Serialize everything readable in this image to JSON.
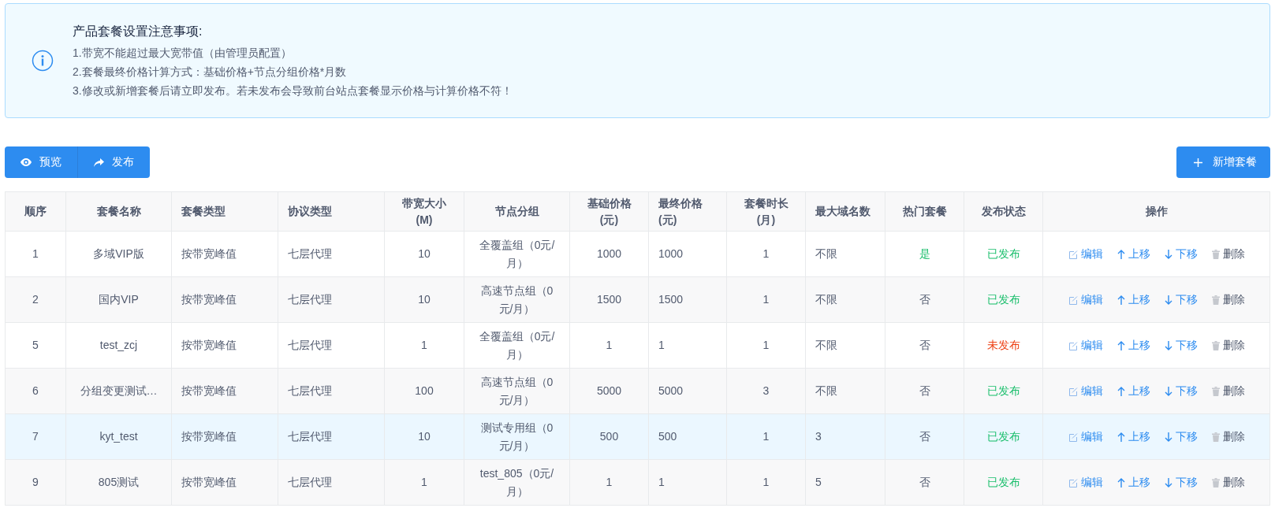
{
  "notice": {
    "title": "产品套餐设置注意事项:",
    "items": [
      "1.带宽不能超过最大宽带值（由管理员配置）",
      "2.套餐最终价格计算方式：基础价格+节点分组价格*月数",
      "3.修改或新增套餐后请立即发布。若未发布会导致前台站点套餐显示价格与计算价格不符！"
    ]
  },
  "toolbar": {
    "buttons": [
      {
        "label": "预览",
        "kind": "preview"
      },
      {
        "label": "发布",
        "kind": "publish"
      }
    ],
    "add_button": {
      "label": "新增套餐"
    }
  },
  "table": {
    "columns": [
      "顺序",
      "套餐名称",
      "套餐类型",
      "协议类型",
      "带宽大小(M)",
      "节点分组",
      "基础价格(元)",
      "最终价格(元)",
      "套餐时长(月)",
      "最大域名数",
      "热门套餐",
      "发布状态",
      "操作"
    ],
    "rows": [
      {
        "selected": false,
        "cells": [
          "1",
          "多域VIP版",
          "按带宽峰值",
          "七层代理",
          "10",
          "全覆盖组（0元/月）",
          "1000",
          "1000",
          "1",
          "不限"
        ],
        "hot": {
          "text": "是",
          "on": true
        },
        "status": {
          "text": "已发布",
          "published": true
        },
        "actions": [
          {
            "label": "编辑",
            "kind": "edit"
          },
          {
            "label": "上移",
            "kind": "up"
          },
          {
            "label": "下移",
            "kind": "down"
          },
          {
            "label": "删除",
            "kind": "delete"
          }
        ]
      },
      {
        "selected": false,
        "cells": [
          "2",
          "国内VIP",
          "按带宽峰值",
          "七层代理",
          "10",
          "高速节点组（0元/月）",
          "1500",
          "1500",
          "1",
          "不限"
        ],
        "hot": {
          "text": "否",
          "on": false
        },
        "status": {
          "text": "已发布",
          "published": true
        },
        "actions": [
          {
            "label": "编辑",
            "kind": "edit"
          },
          {
            "label": "上移",
            "kind": "up"
          },
          {
            "label": "下移",
            "kind": "down"
          },
          {
            "label": "删除",
            "kind": "delete"
          }
        ]
      },
      {
        "selected": false,
        "cells": [
          "5",
          "test_zcj",
          "按带宽峰值",
          "七层代理",
          "1",
          "全覆盖组（0元/月）",
          "1",
          "1",
          "1",
          "不限"
        ],
        "hot": {
          "text": "否",
          "on": false
        },
        "status": {
          "text": "未发布",
          "published": false
        },
        "actions": [
          {
            "label": "编辑",
            "kind": "edit"
          },
          {
            "label": "上移",
            "kind": "up"
          },
          {
            "label": "下移",
            "kind": "down"
          },
          {
            "label": "删除",
            "kind": "delete"
          }
        ]
      },
      {
        "selected": false,
        "cells": [
          "6",
          "分组变更测试…",
          "按带宽峰值",
          "七层代理",
          "100",
          "高速节点组（0元/月）",
          "5000",
          "5000",
          "3",
          "不限"
        ],
        "hot": {
          "text": "否",
          "on": false
        },
        "status": {
          "text": "已发布",
          "published": true
        },
        "actions": [
          {
            "label": "编辑",
            "kind": "edit"
          },
          {
            "label": "上移",
            "kind": "up"
          },
          {
            "label": "下移",
            "kind": "down"
          },
          {
            "label": "删除",
            "kind": "delete"
          }
        ]
      },
      {
        "selected": true,
        "cells": [
          "7",
          "kyt_test",
          "按带宽峰值",
          "七层代理",
          "10",
          "测试专用组（0元/月）",
          "500",
          "500",
          "1",
          "3"
        ],
        "hot": {
          "text": "否",
          "on": false
        },
        "status": {
          "text": "已发布",
          "published": true
        },
        "actions": [
          {
            "label": "编辑",
            "kind": "edit"
          },
          {
            "label": "上移",
            "kind": "up"
          },
          {
            "label": "下移",
            "kind": "down"
          },
          {
            "label": "删除",
            "kind": "delete"
          }
        ]
      },
      {
        "selected": false,
        "cells": [
          "9",
          "805测试",
          "按带宽峰值",
          "七层代理",
          "1",
          "test_805（0元/月）",
          "1",
          "1",
          "1",
          "5"
        ],
        "hot": {
          "text": "否",
          "on": false
        },
        "status": {
          "text": "已发布",
          "published": true
        },
        "actions": [
          {
            "label": "编辑",
            "kind": "edit"
          },
          {
            "label": "上移",
            "kind": "up"
          },
          {
            "label": "下移",
            "kind": "down"
          },
          {
            "label": "删除",
            "kind": "delete"
          }
        ]
      }
    ]
  }
}
